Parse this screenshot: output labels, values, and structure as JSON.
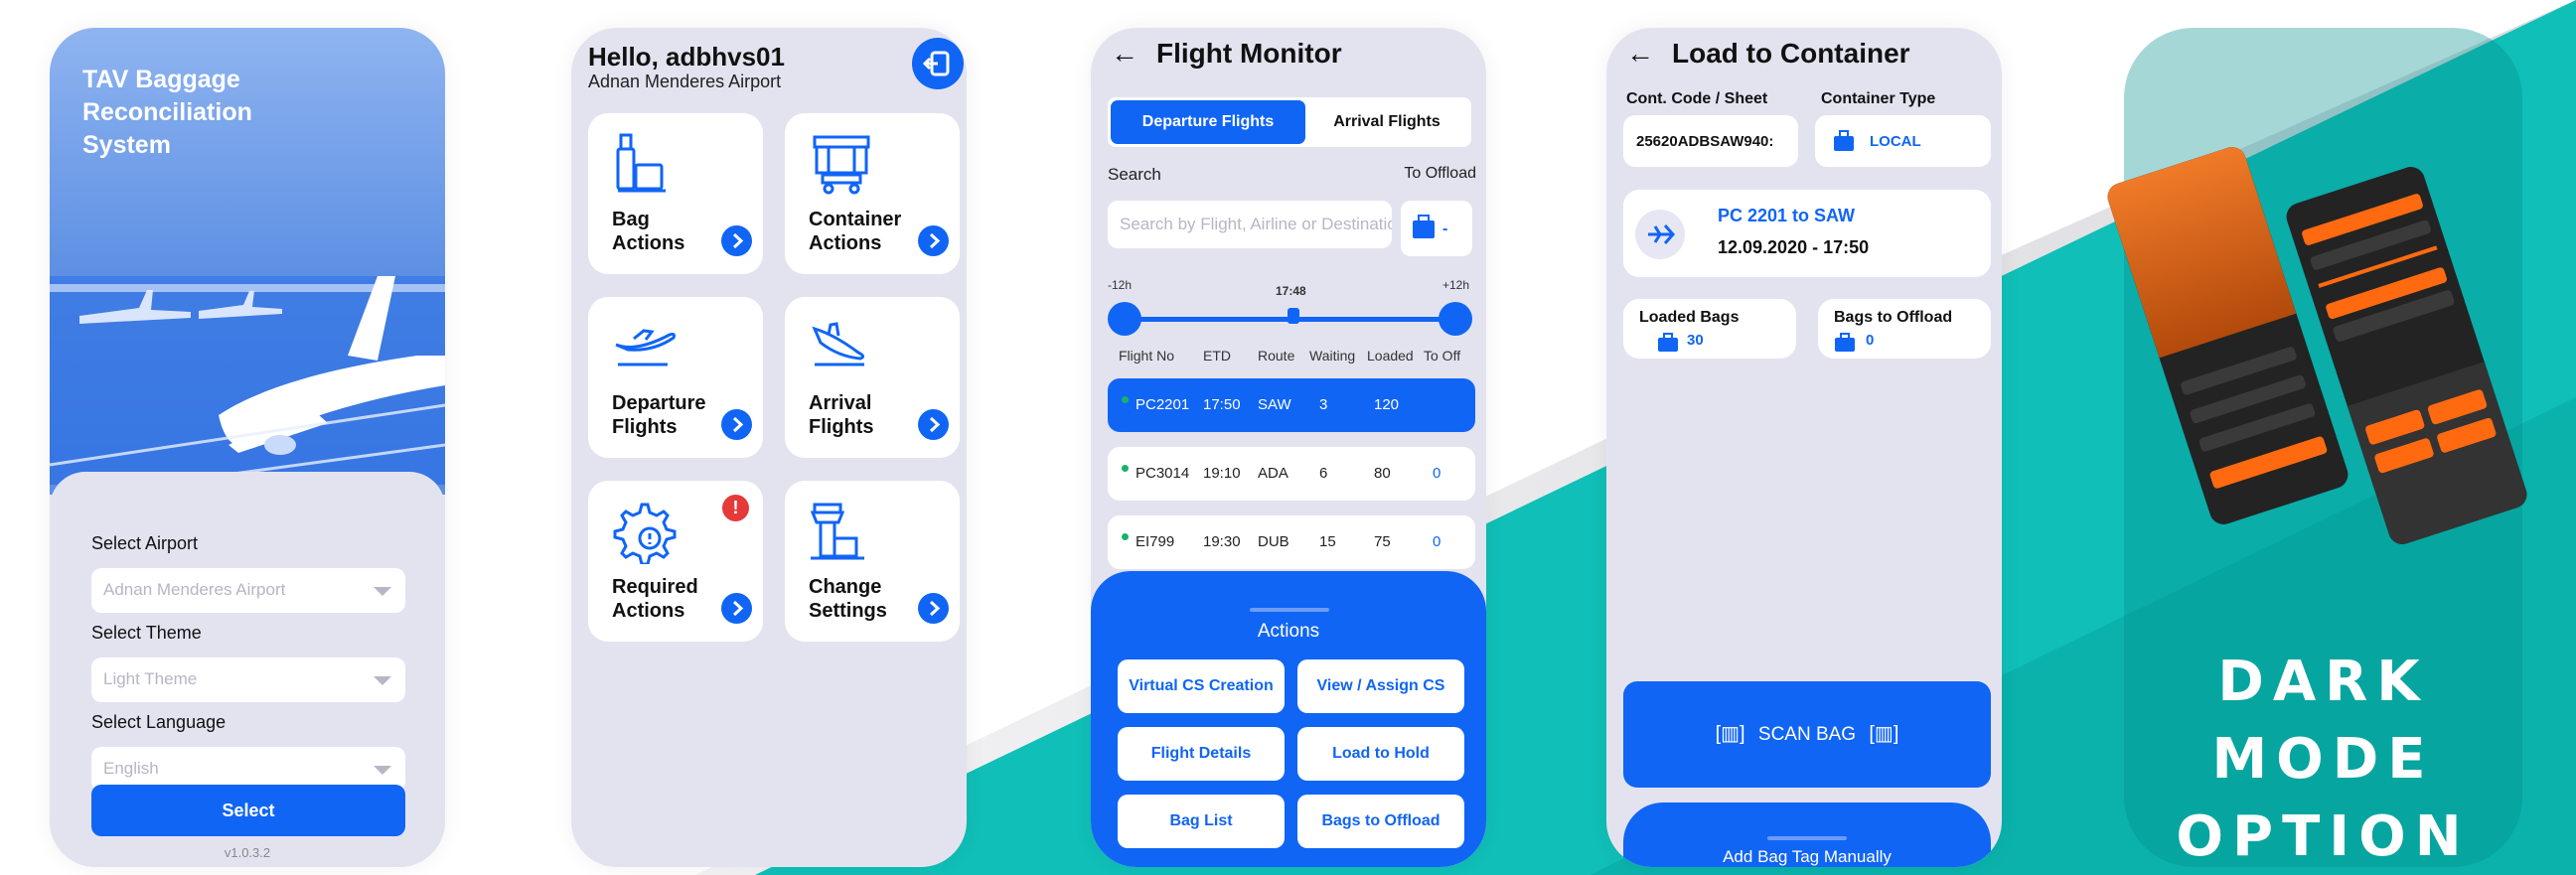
{
  "colors": {
    "accent": "#1065f5",
    "panel": "#e3e3f0",
    "teal": "#10bfb7",
    "alert": "#e43a3a",
    "online": "#17b26a",
    "dark_accent": "#ff6a10"
  },
  "login": {
    "title": "TAV Baggage Reconciliation System",
    "airport_label": "Select Airport",
    "airport_value": "Adnan Menderes Airport",
    "theme_label": "Select Theme",
    "theme_value": "Light Theme",
    "language_label": "Select Language",
    "language_value": "English",
    "select_button": "Select",
    "version": "v1.0.3.2"
  },
  "home": {
    "greeting": "Hello, adbhvs01",
    "airport": "Adnan Menderes Airport",
    "logout_icon": "logout-icon",
    "alert_badge": "!",
    "tiles": [
      {
        "label": "Bag Actions",
        "icon": "bag-actions-icon"
      },
      {
        "label": "Container Actions",
        "icon": "container-icon"
      },
      {
        "label": "Departure Flights",
        "icon": "departure-plane-icon"
      },
      {
        "label": "Arrival Flights",
        "icon": "arrival-plane-icon"
      },
      {
        "label": "Required Actions",
        "icon": "gear-alert-icon"
      },
      {
        "label": "Change Settings",
        "icon": "tower-icon"
      }
    ]
  },
  "flight_monitor": {
    "title": "Flight Monitor",
    "tabs": [
      "Departure Flights",
      "Arrival Flights"
    ],
    "active_tab": "Departure Flights",
    "search_label": "Search",
    "search_placeholder": "Search by Flight, Airline or Destination",
    "to_offload_label": "To Offload",
    "offload_filter": "-",
    "slider": {
      "min_label": "-12h",
      "current_label": "17:48",
      "max_label": "+12h"
    },
    "columns": [
      "Flight No",
      "ETD",
      "Route",
      "Waiting",
      "Loaded",
      "To Off"
    ],
    "rows": [
      {
        "flight": "PC2201",
        "etd": "17:50",
        "route": "SAW",
        "waiting": "3",
        "loaded": "120",
        "to_off": "",
        "selected": true
      },
      {
        "flight": "PC3014",
        "etd": "19:10",
        "route": "ADA",
        "waiting": "6",
        "loaded": "80",
        "to_off": "0",
        "selected": false
      },
      {
        "flight": "EI799",
        "etd": "19:30",
        "route": "DUB",
        "waiting": "15",
        "loaded": "75",
        "to_off": "0",
        "selected": false
      }
    ],
    "actions_title": "Actions",
    "actions": [
      "Virtual CS Creation",
      "View / Assign CS",
      "Flight Details",
      "Load to Hold",
      "Bag List",
      "Bags to Offload"
    ]
  },
  "load_container": {
    "title": "Load to Container",
    "code_label": "Cont. Code / Sheet",
    "code_value": "25620ADBSAW940:",
    "type_label": "Container Type",
    "type_value": "LOCAL",
    "flight_title": "PC 2201 to SAW",
    "flight_datetime": "12.09.2020 - 17:50",
    "loaded_label": "Loaded Bags",
    "loaded_value": "30",
    "offload_label": "Bags to Offload",
    "offload_value": "0",
    "scan_button": "SCAN BAG",
    "manual_label": "Add Bag Tag Manually"
  },
  "dark_mode": {
    "line1": "DARK MODE",
    "line2": "OPTION"
  }
}
